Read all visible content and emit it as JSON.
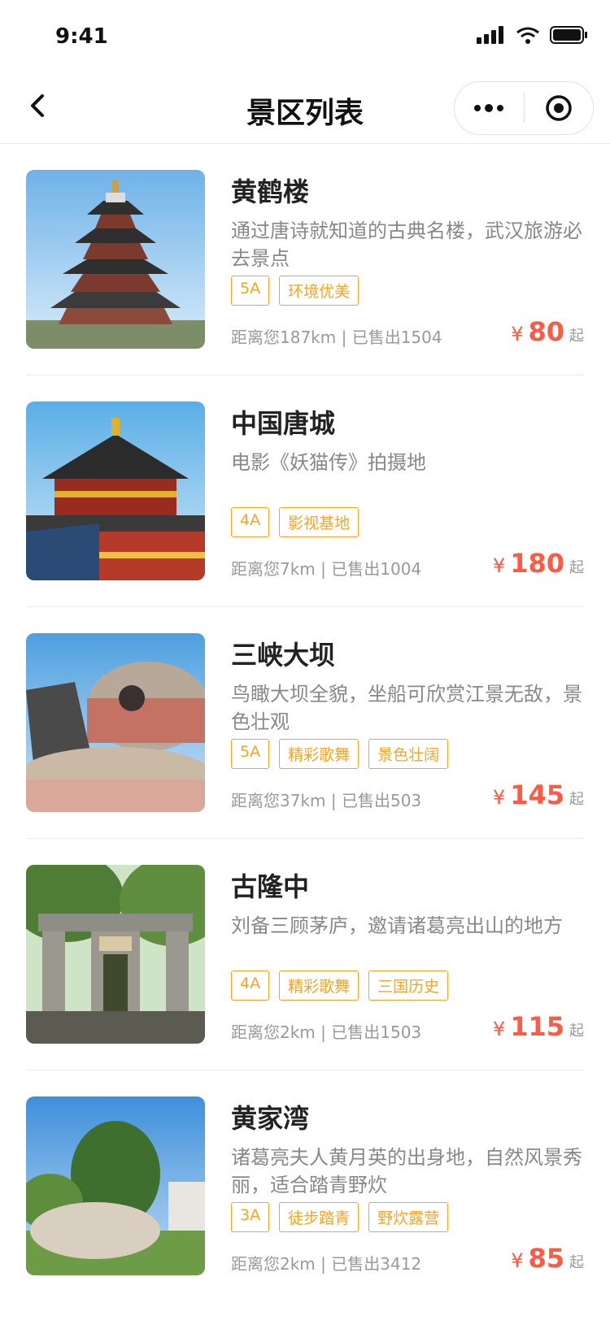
{
  "status_bar": {
    "time": "9:41"
  },
  "nav": {
    "title": "景区列表"
  },
  "spots": [
    {
      "name": "黄鹤楼",
      "desc": "通过唐诗就知道的古典名楼，武汉旅游必去景点",
      "tags": [
        "5A",
        "环境优美"
      ],
      "meta": "距离您187km | 已售出1504",
      "currency": "¥",
      "price": "80",
      "suffix": "起"
    },
    {
      "name": "中国唐城",
      "desc": "电影《妖猫传》拍摄地",
      "tags": [
        "4A",
        "影视基地"
      ],
      "meta": "距离您7km | 已售出1004",
      "currency": "¥",
      "price": "180",
      "suffix": "起"
    },
    {
      "name": "三峡大坝",
      "desc": "鸟瞰大坝全貌，坐船可欣赏江景无敌，景色壮观",
      "tags": [
        "5A",
        "精彩歌舞",
        "景色壮阔"
      ],
      "meta": "距离您37km | 已售出503",
      "currency": "¥",
      "price": "145",
      "suffix": "起"
    },
    {
      "name": "古隆中",
      "desc": "刘备三顾茅庐，邀请诸葛亮出山的地方",
      "tags": [
        "4A",
        "精彩歌舞",
        "三国历史"
      ],
      "meta": "距离您2km | 已售出1503",
      "currency": "¥",
      "price": "115",
      "suffix": "起"
    },
    {
      "name": "黄家湾",
      "desc": "诸葛亮夫人黄月英的出身地，自然风景秀丽，适合踏青野炊",
      "tags": [
        "3A",
        "徒步踏青",
        "野炊露营"
      ],
      "meta": "距离您2km | 已售出3412",
      "currency": "¥",
      "price": "85",
      "suffix": "起"
    }
  ],
  "colors": {
    "accent": "#ff5a43",
    "tag": "#f5a623"
  },
  "icons": [
    "signal-icon",
    "wifi-icon",
    "battery-icon",
    "back-arrow-icon",
    "more-icon",
    "target-icon"
  ]
}
